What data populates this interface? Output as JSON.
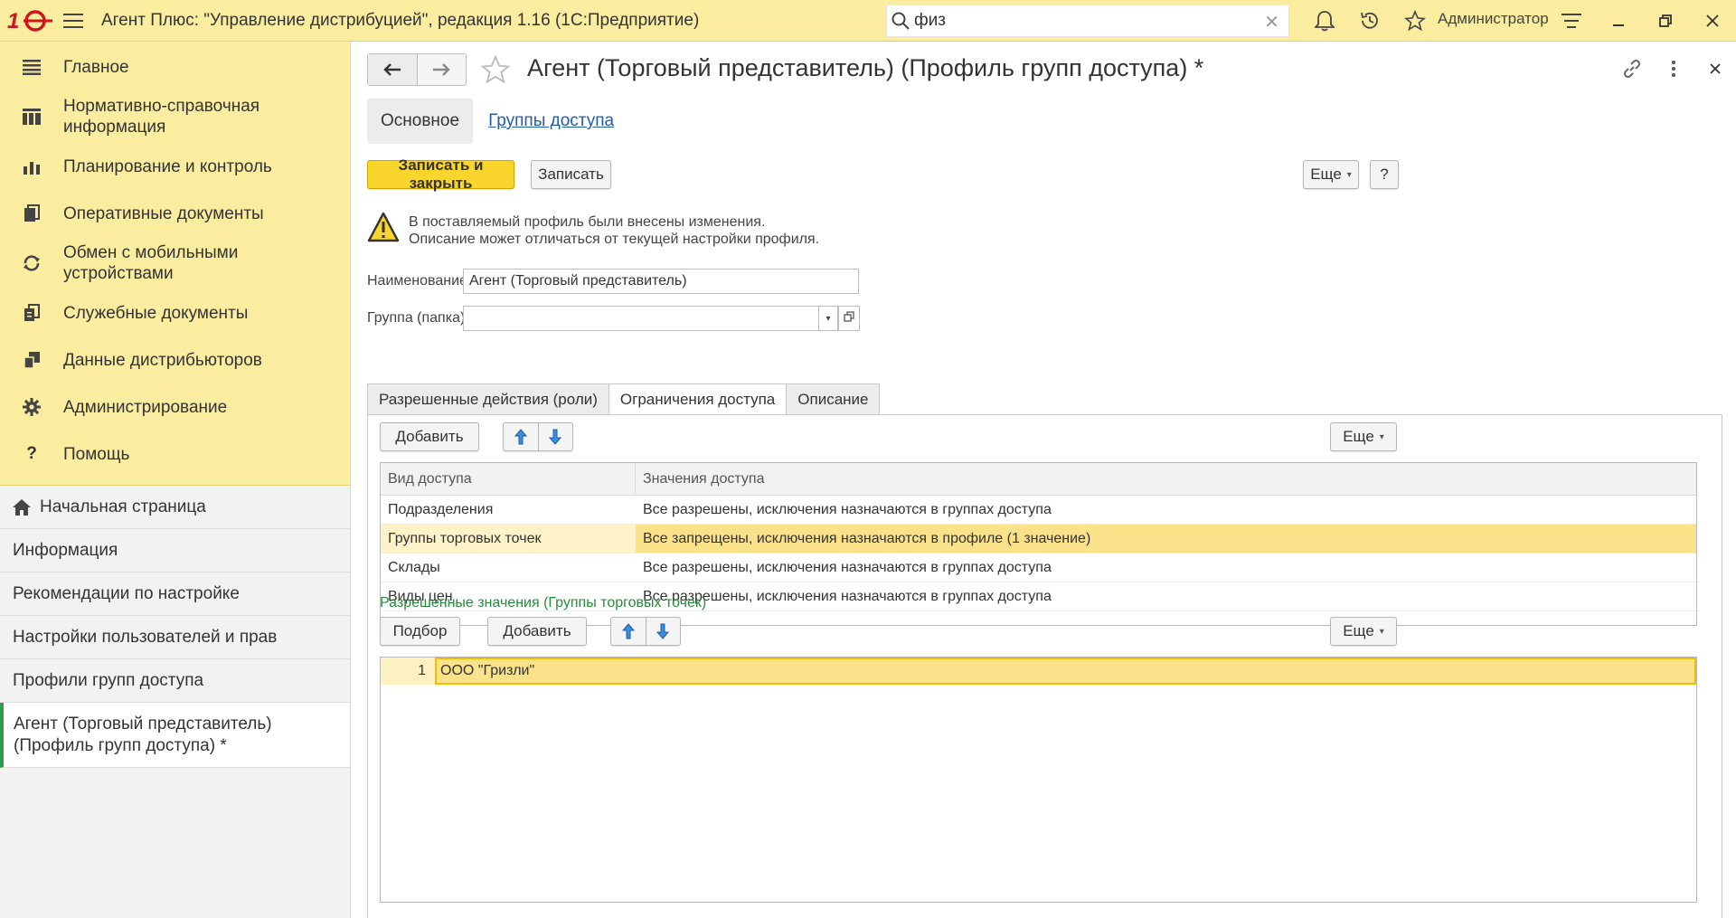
{
  "app": {
    "logo": "1С",
    "title": "Агент Плюс: \"Управление дистрибуцией\", редакция 1.16  (1С:Предприятие)",
    "search_value": "физ",
    "user": "Администратор"
  },
  "sidebar": {
    "sections": [
      {
        "label": "Главное",
        "icon": "menu-lines-icon"
      },
      {
        "label": "Нормативно-справочная информация",
        "icon": "catalog-icon"
      },
      {
        "label": "Планирование и контроль",
        "icon": "bar-chart-icon"
      },
      {
        "label": "Оперативные документы",
        "icon": "documents-icon"
      },
      {
        "label": "Обмен с мобильными устройствами",
        "icon": "sync-icon"
      },
      {
        "label": "Служебные документы",
        "icon": "service-docs-icon"
      },
      {
        "label": "Данные дистрибьюторов",
        "icon": "distributor-data-icon"
      },
      {
        "label": "Администрирование",
        "icon": "gear-icon"
      },
      {
        "label": "Помощь",
        "icon": "help-icon"
      }
    ],
    "open_windows": [
      {
        "label": "Начальная страница"
      },
      {
        "label": "Информация"
      },
      {
        "label": "Рекомендации по настройке"
      },
      {
        "label": "Настройки пользователей и прав"
      },
      {
        "label": "Профили групп доступа"
      },
      {
        "label": "Агент (Торговый представитель) (Профиль групп доступа) *"
      }
    ]
  },
  "form": {
    "title": "Агент (Торговый представитель) (Профиль групп доступа) *",
    "tabs": {
      "main": "Основное",
      "link": "Группы доступа"
    },
    "buttons": {
      "save_close": "Записать и закрыть",
      "save": "Записать",
      "more": "Еще",
      "help": "?"
    },
    "warning": {
      "line1": "В поставляемый профиль были внесены изменения.",
      "line2": "Описание может отличаться от текущей настройки профиля."
    },
    "fields": {
      "name_label": "Наименование:",
      "name_value": "Агент (Торговый представитель)",
      "group_label": "Группа (папка):",
      "group_value": ""
    },
    "inner_tabs": [
      "Разрешенные действия (роли)",
      "Ограничения доступа",
      "Описание"
    ],
    "restrictions": {
      "add_label": "Добавить",
      "more_label": "Еще",
      "columns": [
        "Вид доступа",
        "Значения доступа"
      ],
      "rows": [
        {
          "kind": "Подразделения",
          "value": "Все разрешены, исключения назначаются в группах доступа"
        },
        {
          "kind": "Группы торговых точек",
          "value": "Все запрещены, исключения назначаются в профиле (1 значение)"
        },
        {
          "kind": "Склады",
          "value": "Все разрешены, исключения назначаются в группах доступа"
        },
        {
          "kind": "Виды цен",
          "value": "Все разрешены, исключения назначаются в группах доступа"
        }
      ]
    },
    "allowed": {
      "title": "Разрешенные значения (Группы торговых точек)",
      "pick_label": "Подбор",
      "add_label": "Добавить",
      "more_label": "Еще",
      "rows": [
        {
          "n": "1",
          "value": "ООО \"Гризли\""
        }
      ]
    }
  },
  "colors": {
    "accent_yellow": "#fad52b",
    "panel_yellow": "#fbeda0",
    "selection": "#fae28a",
    "link_blue": "#1f5fa8",
    "green_title": "#2a8a3c",
    "logo_red": "#d0141d"
  }
}
